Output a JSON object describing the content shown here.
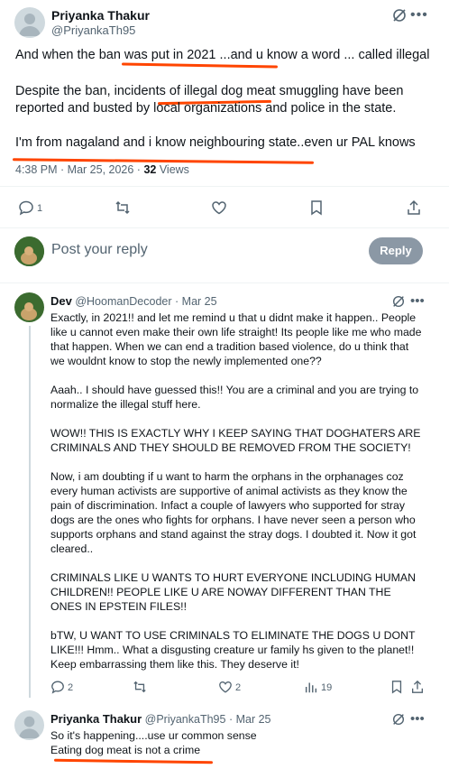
{
  "main_post": {
    "name": "Priyanka Thakur",
    "handle": "@PriyankaTh95",
    "lines": [
      "And when the ban was put in 2021 ...and u know a word ... called illegal",
      "Despite the ban, incidents of illegal dog meat smuggling have been",
      "reported and busted by local organizations and police in the state.",
      "I'm from nagaland and i know neighbouring state..even ur PAL knows"
    ],
    "timestamp": "4:38 PM · Mar 25, 2026 · ",
    "views_count": "32",
    "views_label": " Views",
    "actions": {
      "reply_count": "1"
    }
  },
  "composer": {
    "placeholder": "Post your reply",
    "button_label": "Reply"
  },
  "reply_dev": {
    "name": "Dev",
    "handle": "@HoomanDecoder",
    "date": "· Mar 25",
    "paragraphs": [
      "Exactly, in 2021!! and let me remind u that u didnt make it happen.. People like u cannot even make their own life straight! Its people like me who made that happen. When we can end a tradition based violence, do u think that we wouldnt know to stop the newly implemented one??",
      "Aaah.. I should have guessed this!! You are a criminal and you are trying to normalize the illegal stuff here.",
      "WOW!! THIS IS EXACTLY WHY I KEEP SAYING THAT DOGHATERS ARE CRIMINALS AND THEY SHOULD BE REMOVED FROM THE SOCIETY!",
      "Now, i am doubting if u want to harm the orphans in the orphanages coz every human activists are supportive of animal activists as they know the pain of discrimination. Infact a couple of lawyers who supported for stray dogs are the ones who fights for orphans. I have never seen a person who supports orphans and stand against the stray dogs. I doubted it. Now it got cleared..",
      "CRIMINALS LIKE U WANTS TO HURT EVERYONE INCLUDING HUMAN CHILDREN!! PEOPLE LIKE U ARE NOWAY DIFFERENT THAN THE ONES IN EPSTEIN FILES!!",
      "bTW, U WANT TO USE CRIMINALS TO ELIMINATE THE DOGS U DONT LIKE!!! Hmm.. What a disgusting creature ur family hs given to the planet!! Keep embarrassing them like this. They deserve it!"
    ],
    "reply_count": "2",
    "like_count": "2",
    "view_count": "19"
  },
  "reply_priyanka": {
    "name": "Priyanka Thakur",
    "handle": "@PriyankaTh95",
    "date": "· Mar 25",
    "lines": [
      "So it's happening....use ur common sense",
      "Eating dog meat is not a crime"
    ]
  },
  "colors": {
    "annotation": "#ff4500",
    "reply_button": "#8b98a5",
    "secondary_text": "#536471"
  }
}
